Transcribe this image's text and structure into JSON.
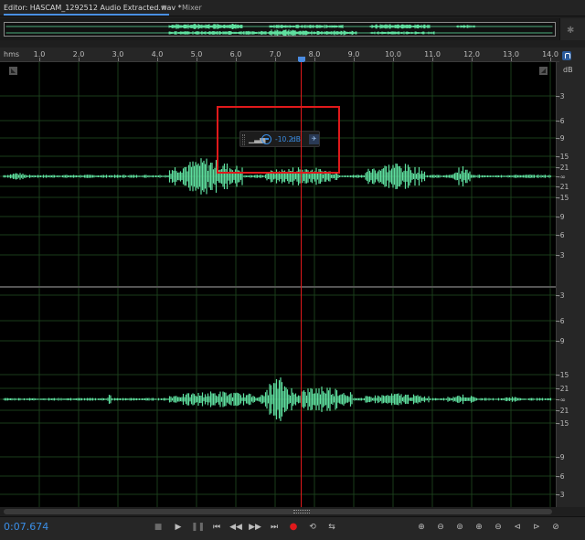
{
  "tabs": {
    "editor_label": "Editor: HASCAM_1292512 Audio Extracted.wav *",
    "editor_menu_icon": "≡",
    "mixer_label": "Mixer"
  },
  "ruler": {
    "unit_label": "hms",
    "labels": [
      "1.0",
      "2.0",
      "3.0",
      "4.0",
      "5.0",
      "6.0",
      "7.0",
      "8.0",
      "9.0",
      "10.0",
      "11.0",
      "12.0",
      "13.0",
      "14.0"
    ]
  },
  "scale": {
    "db_label": "dB",
    "ch1": [
      "-3",
      "-6",
      "-9",
      "-15",
      "-21",
      "-∞",
      "-21",
      "-15",
      "-9",
      "-6",
      "-3"
    ],
    "ch2": [
      "-3",
      "-6",
      "-9",
      "-15",
      "-21",
      "-∞",
      "-21",
      "-15",
      "-9",
      "-6",
      "-3"
    ]
  },
  "hud": {
    "value": "-10.2",
    "unit": "dB",
    "bars_icon": "signal-bars-icon",
    "pin_icon": "pin-icon"
  },
  "transport": {
    "timecode": "0:07.674",
    "buttons": [
      "stop",
      "play",
      "pause",
      "go-to-previous",
      "rewind",
      "fast-forward",
      "go-to-next",
      "record",
      "loop",
      "skip-selection"
    ],
    "zoom_buttons": [
      "zoom-in-amplitude",
      "zoom-out-amplitude",
      "zoom-to-selection",
      "zoom-in-time",
      "zoom-out-time",
      "zoom-in-left",
      "zoom-in-right",
      "zoom-out-full"
    ]
  },
  "colors": {
    "waveform": "#5fe0a0",
    "playhead": "#e0191b",
    "accent": "#3a8ee6",
    "grid": "#1a3d1a",
    "background": "#000000"
  },
  "playhead_time_s": 7.674
}
